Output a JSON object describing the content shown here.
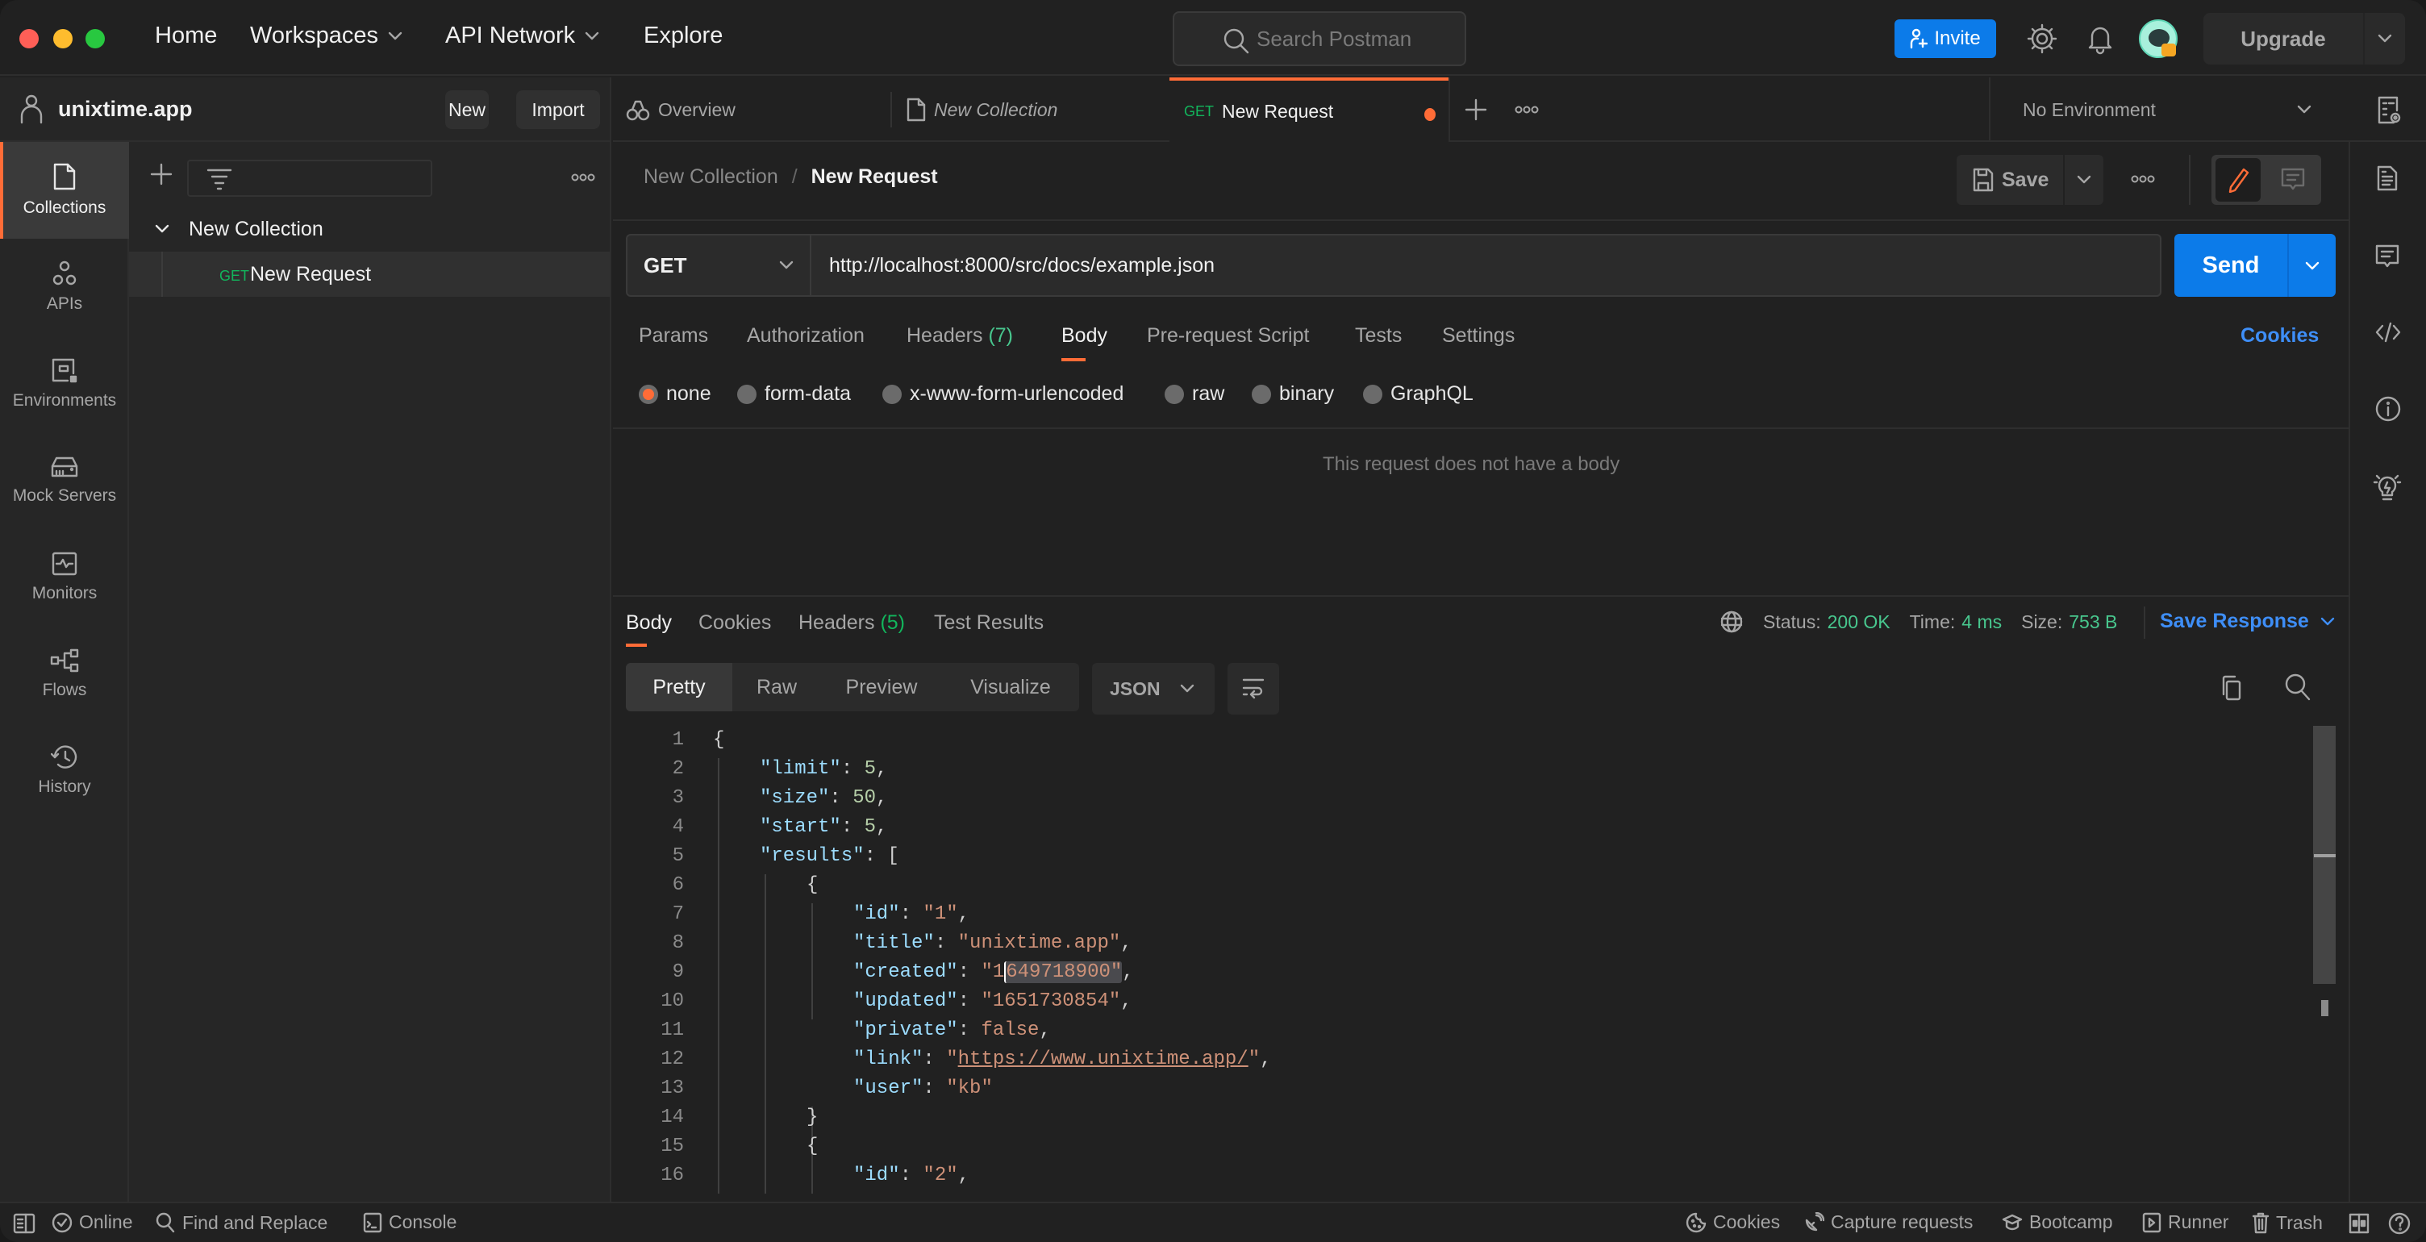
{
  "titlebar": {
    "nav": [
      "Home",
      "Workspaces",
      "API Network",
      "Explore"
    ],
    "search_placeholder": "Search Postman",
    "invite_label": "Invite",
    "upgrade_label": "Upgrade"
  },
  "workspace": {
    "name": "unixtime.app",
    "new_label": "New",
    "import_label": "Import"
  },
  "rail": [
    {
      "label": "Collections",
      "icon": "collections-icon",
      "active": true
    },
    {
      "label": "APIs",
      "icon": "apis-icon"
    },
    {
      "label": "Environments",
      "icon": "environments-icon"
    },
    {
      "label": "Mock Servers",
      "icon": "mock-servers-icon"
    },
    {
      "label": "Monitors",
      "icon": "monitors-icon"
    },
    {
      "label": "Flows",
      "icon": "flows-icon"
    },
    {
      "label": "History",
      "icon": "history-icon"
    }
  ],
  "tree": {
    "collection": "New Collection",
    "request_method": "GET",
    "request_name": "New Request"
  },
  "tabs": [
    {
      "label": "Overview"
    },
    {
      "label": "New Collection"
    },
    {
      "method": "GET",
      "label": "New Request",
      "active": true,
      "unsaved": true
    }
  ],
  "environment": "No Environment",
  "request": {
    "breadcrumb_parent": "New Collection",
    "breadcrumb_sep": "/",
    "breadcrumb_current": "New Request",
    "save_label": "Save",
    "method": "GET",
    "url": "http://localhost:8000/src/docs/example.json",
    "send_label": "Send",
    "tabs": [
      "Params",
      "Authorization",
      "Headers",
      "Body",
      "Pre-request Script",
      "Tests",
      "Settings"
    ],
    "headers_count": "(7)",
    "active_tab": "Body",
    "cookies_label": "Cookies",
    "body_types": [
      "none",
      "form-data",
      "x-www-form-urlencoded",
      "raw",
      "binary",
      "GraphQL"
    ],
    "selected_body_type": "none",
    "empty_body_message": "This request does not have a body"
  },
  "response": {
    "tabs": [
      "Body",
      "Cookies",
      "Headers",
      "Test Results"
    ],
    "headers_count": "(5)",
    "status_label": "Status:",
    "status_value": "200 OK",
    "time_label": "Time:",
    "time_value": "4 ms",
    "size_label": "Size:",
    "size_value": "753 B",
    "save_response_label": "Save Response",
    "views": [
      "Pretty",
      "Raw",
      "Preview",
      "Visualize"
    ],
    "active_view": "Pretty",
    "format": "JSON",
    "lines": [
      "1",
      "2",
      "3",
      "4",
      "5",
      "6",
      "7",
      "8",
      "9",
      "10",
      "11",
      "12",
      "13",
      "14",
      "15",
      "16"
    ],
    "code": {
      "l1": "{",
      "limit_k": "\"limit\"",
      "limit_v": "5",
      "size_k": "\"size\"",
      "size_v": "50",
      "start_k": "\"start\"",
      "start_v": "5",
      "results_k": "\"results\"",
      "id_k": "\"id\"",
      "id_v": "\"1\"",
      "title_k": "\"title\"",
      "title_v": "\"unixtime.app\"",
      "created_k": "\"created\"",
      "created_v_open": "\"1",
      "created_v_sel": "649718900\"",
      "updated_k": "\"updated\"",
      "updated_v": "\"1651730854\"",
      "private_k": "\"private\"",
      "private_v": "false",
      "link_k": "\"link\"",
      "link_v": "https://www.unixtime.app/",
      "user_k": "\"user\"",
      "user_v": "\"kb\"",
      "id2_k": "\"id\"",
      "id2_v": "\"2\""
    }
  },
  "statusbar": {
    "online": "Online",
    "find_replace": "Find and Replace",
    "console": "Console",
    "cookies": "Cookies",
    "capture": "Capture requests",
    "bootcamp": "Bootcamp",
    "runner": "Runner",
    "trash": "Trash"
  },
  "colors": {
    "accent": "#ff6c37",
    "primary": "#0c7be9",
    "success": "#12b55c",
    "link": "#3e8ef7"
  }
}
